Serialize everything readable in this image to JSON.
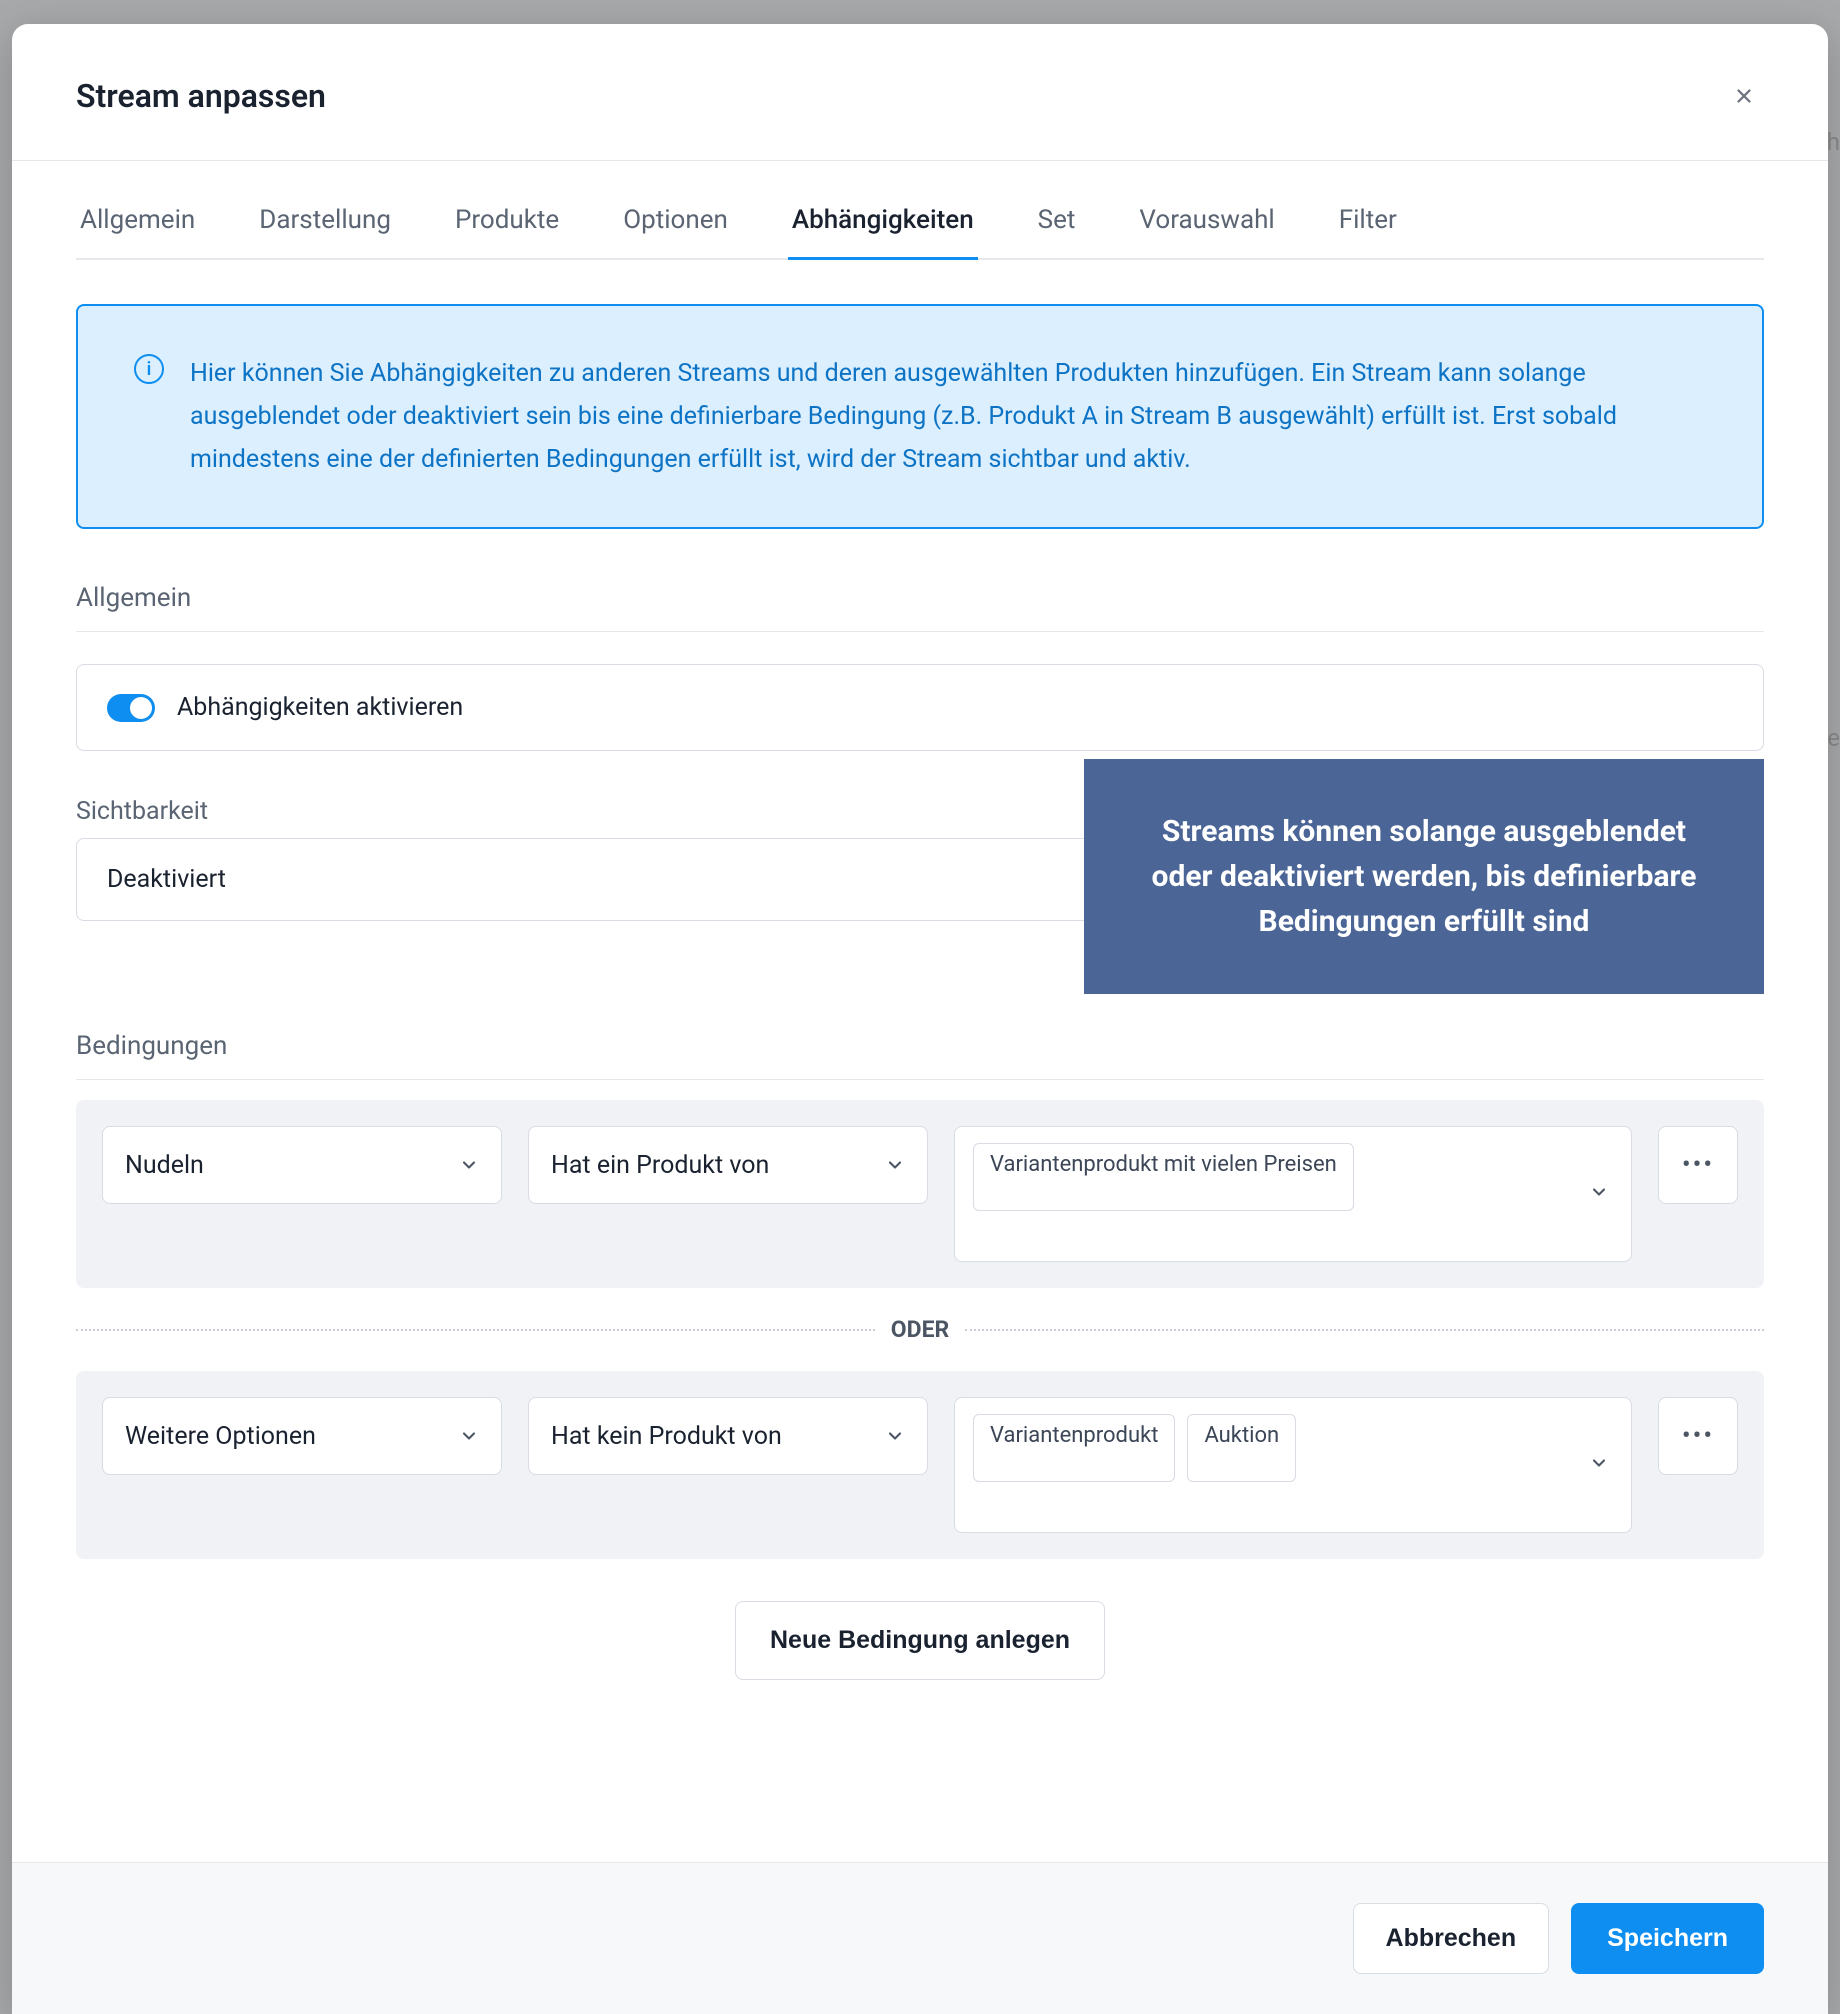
{
  "modal": {
    "title": "Stream anpassen"
  },
  "tabs": {
    "items": [
      {
        "label": "Allgemein"
      },
      {
        "label": "Darstellung"
      },
      {
        "label": "Produkte"
      },
      {
        "label": "Optionen"
      },
      {
        "label": "Abhängigkeiten"
      },
      {
        "label": "Set"
      },
      {
        "label": "Vorauswahl"
      },
      {
        "label": "Filter"
      }
    ],
    "active_index": 4
  },
  "info": {
    "text": "Hier können Sie Abhängigkeiten zu anderen Streams und deren ausgewählten Produkten hinzufügen. Ein Stream kann solange ausgeblendet oder deaktiviert sein bis eine definierbare Bedingung (z.B. Produkt A in Stream B ausgewählt) erfüllt ist. Erst sobald mindestens eine der definierten Bedingungen erfüllt ist, wird der Stream sichtbar und aktiv."
  },
  "general": {
    "title": "Allgemein",
    "toggle_label": "Abhängigkeiten aktivieren",
    "toggle_on": true
  },
  "visibility": {
    "label": "Sichtbarkeit",
    "value": "Deaktiviert"
  },
  "conditions": {
    "title": "Bedingungen",
    "separator": "ODER",
    "new_button": "Neue Bedingung anlegen",
    "rows": [
      {
        "stream": "Nudeln",
        "operator": "Hat ein Produkt von",
        "tags": [
          "Variantenprodukt mit vielen Preisen"
        ]
      },
      {
        "stream": "Weitere Optionen",
        "operator": "Hat kein Produkt von",
        "tags": [
          "Variantenprodukt",
          "Auktion"
        ]
      }
    ]
  },
  "callout": {
    "text": "Streams können solange ausgeblendet oder deaktiviert werden, bis definierbare Bedingungen erfüllt sind"
  },
  "footer": {
    "cancel": "Abbrechen",
    "save": "Speichern"
  },
  "help_char": "?",
  "info_char": "i",
  "dots": "•••",
  "background_text": {
    "right1": "ech",
    "right2": "ne"
  }
}
